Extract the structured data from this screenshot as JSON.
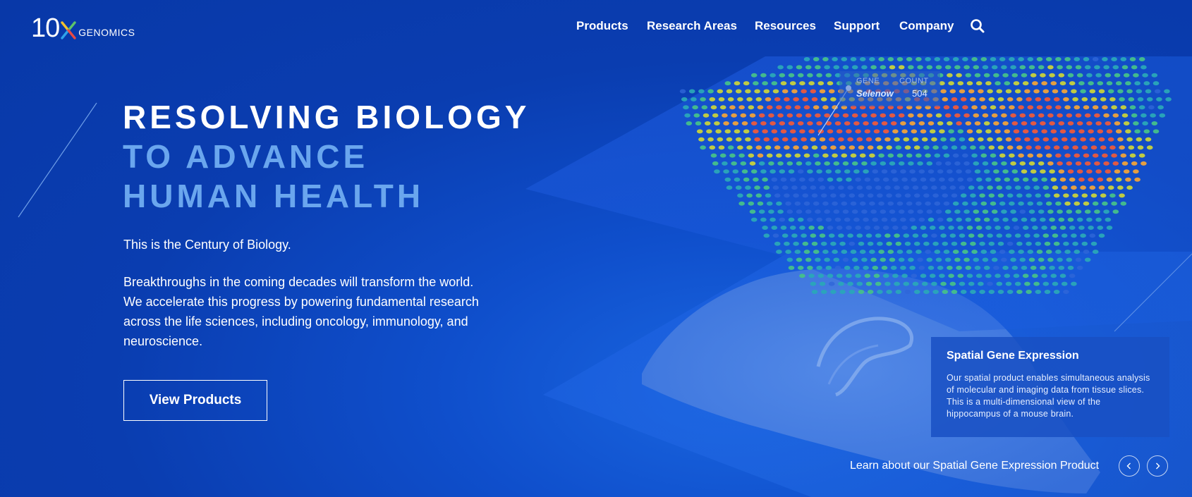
{
  "brand": {
    "logo_number": "10",
    "logo_text": "GENOMICS",
    "colors": {
      "background": "#0a3db0",
      "accent_light_blue": "#6aa6ee",
      "x_yellow": "#f2c12e",
      "x_green": "#5cc36a",
      "x_red": "#e84a45",
      "x_blue": "#2fa2ea"
    }
  },
  "nav": {
    "items": [
      {
        "label": "Products"
      },
      {
        "label": "Research Areas"
      },
      {
        "label": "Resources"
      },
      {
        "label": "Support"
      },
      {
        "label": "Company"
      }
    ],
    "search_icon": "search-icon"
  },
  "hero": {
    "title_line1": "RESOLVING BIOLOGY",
    "title_line2": "TO ADVANCE",
    "title_line3": "HUMAN HEALTH",
    "intro": "This is the Century of Biology.",
    "body": "Breakthroughs in the coming decades will transform the world. We accelerate this progress by powering fundamental research across the life sciences, including oncology, immunology, and neuroscience.",
    "cta_label": "View Products"
  },
  "gene_callout": {
    "gene_header": "GENE",
    "count_header": "COUNT",
    "gene_value": "Selenow",
    "count_value": "504"
  },
  "card": {
    "title": "Spatial Gene Expression",
    "description": "Our spatial product enables simultaneous analysis of molecular and imaging data from tissue slices. This is a multi-dimensional view of the hippocampus of a mouse brain."
  },
  "carousel": {
    "link_label": "Learn about our Spatial Gene Expression Product",
    "prev_icon": "chevron-left-icon",
    "next_icon": "chevron-right-icon"
  }
}
